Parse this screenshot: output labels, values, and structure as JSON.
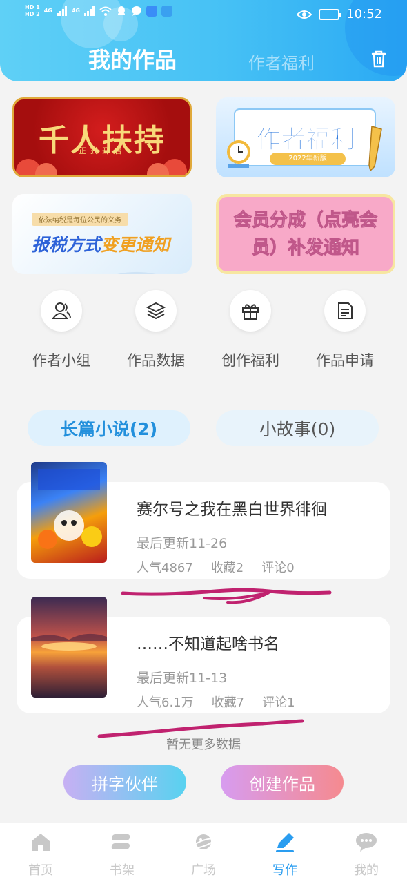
{
  "status_bar": {
    "sim1": "HD 1",
    "sim2": "HD 2",
    "net1": "4G",
    "net2": "4G",
    "time": "10:52"
  },
  "header": {
    "active_tab": "我的作品",
    "other_tab": "作者福利"
  },
  "banners": [
    {
      "title": "千人扶持",
      "subtitle": "正式开启"
    },
    {
      "title": "作者福利",
      "subtitle": "2022年新版"
    },
    {
      "pre": "依法纳税是每位公民的义务",
      "title_a": "报税方式",
      "title_b": "变更通知"
    },
    {
      "title": "会员分成（点亮会员）补发通知"
    }
  ],
  "quick_menu": [
    {
      "label": "作者小组",
      "icon": "group-icon"
    },
    {
      "label": "作品数据",
      "icon": "layers-icon"
    },
    {
      "label": "创作福利",
      "icon": "gift-icon"
    },
    {
      "label": "作品申请",
      "icon": "document-icon"
    }
  ],
  "type_tabs": {
    "novel": "长篇小说(2)",
    "story": "小故事(0)"
  },
  "works": [
    {
      "title": "赛尔号之我在黑白世界徘徊",
      "updated": "最后更新11-26",
      "popularity": "人气4867",
      "favorites": "收藏2",
      "comments": "评论0"
    },
    {
      "title": "……不知道起啥书名",
      "updated": "最后更新11-13",
      "popularity": "人气6.1万",
      "favorites": "收藏7",
      "comments": "评论1"
    }
  ],
  "no_more": "暂无更多数据",
  "actions": {
    "partner": "拼字伙伴",
    "create": "创建作品"
  },
  "bottom_nav": [
    {
      "label": "首页",
      "icon": "home-icon"
    },
    {
      "label": "书架",
      "icon": "bookshelf-icon"
    },
    {
      "label": "广场",
      "icon": "planet-icon"
    },
    {
      "label": "写作",
      "icon": "pen-icon",
      "active": true
    },
    {
      "label": "我的",
      "icon": "chat-bubble-icon"
    }
  ],
  "colors": {
    "accent": "#2a9df0",
    "header": "#46c1f5",
    "scribble": "#c0226f"
  }
}
